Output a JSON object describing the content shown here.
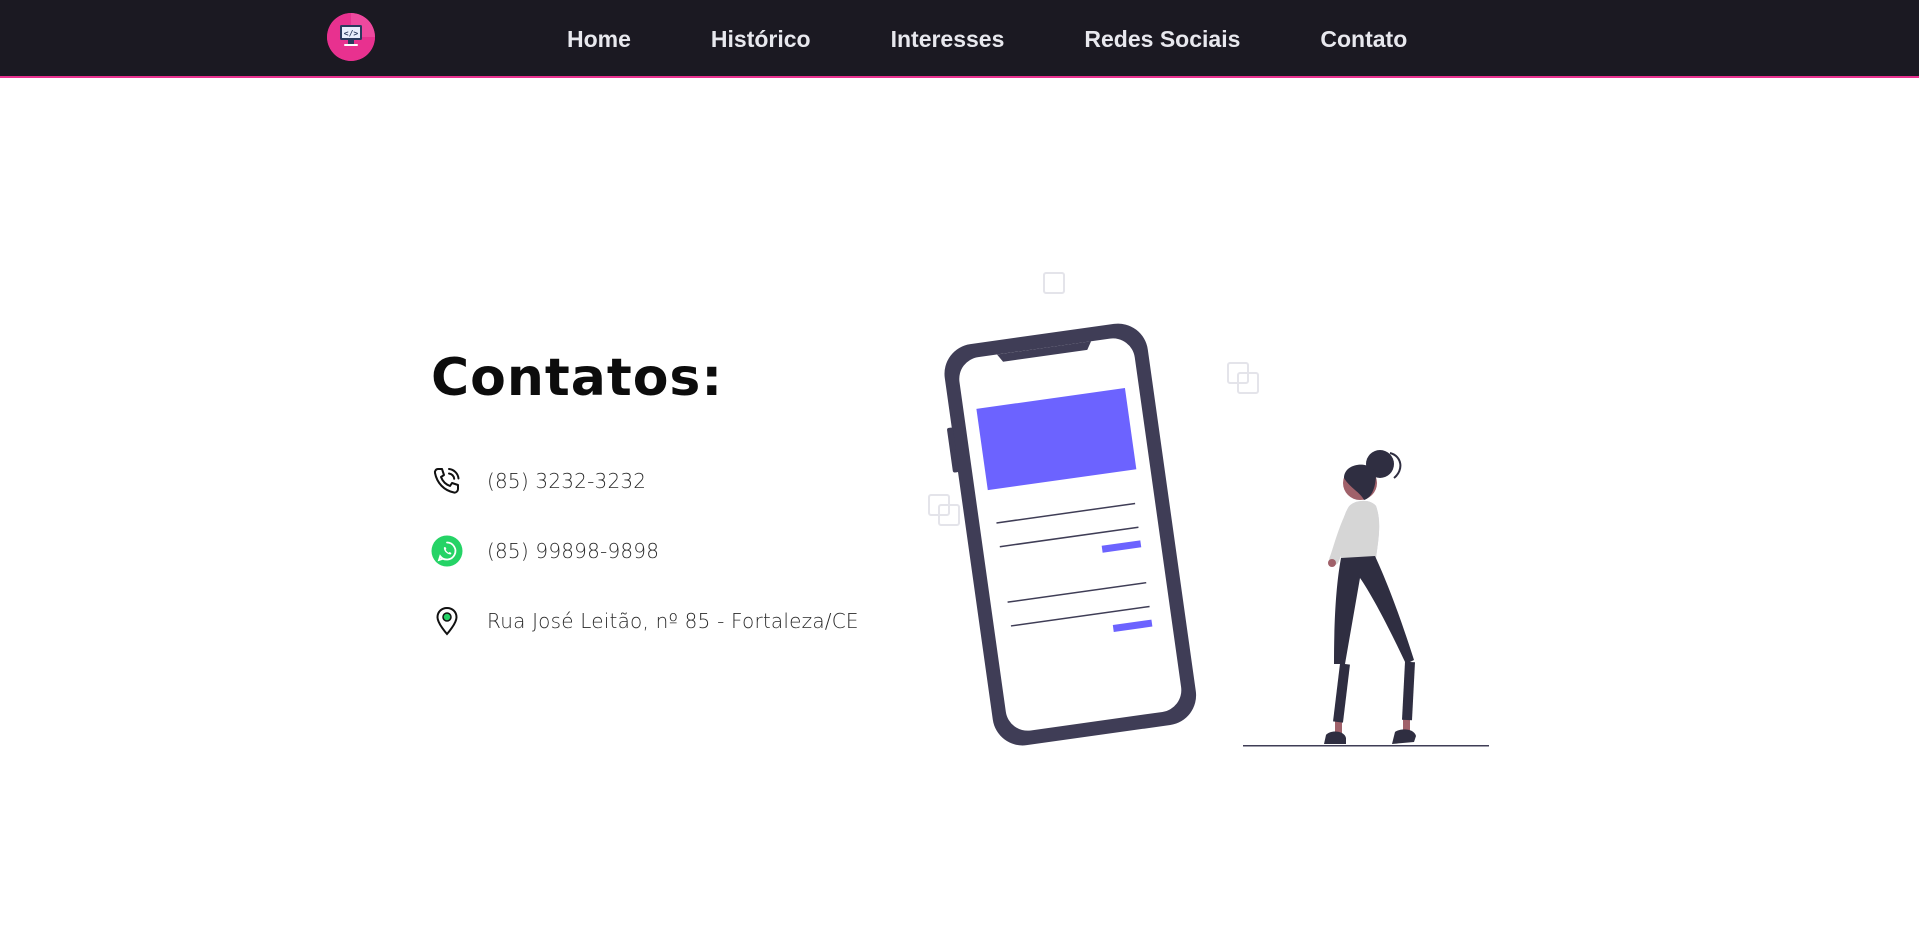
{
  "nav": {
    "logo_icon": "code-monitor-icon",
    "items": [
      {
        "label": "Home"
      },
      {
        "label": "Histórico"
      },
      {
        "label": "Interesses"
      },
      {
        "label": "Redes Sociais"
      },
      {
        "label": "Contato"
      }
    ]
  },
  "contact": {
    "title": "Contatos:",
    "phone": {
      "icon": "phone-icon",
      "text": "(85) 3232-3232"
    },
    "whatsapp": {
      "icon": "whatsapp-icon",
      "text": "(85) 99898-9898"
    },
    "address": {
      "icon": "location-pin-icon",
      "text": "Rua José Leitão, nº 85 - Fortaleza/CE"
    }
  },
  "colors": {
    "navbar_bg": "#1b1922",
    "accent": "#e8318f",
    "illustration_purple": "#6c63ff",
    "phone_frame": "#3f3d56",
    "whatsapp_green": "#25d366"
  }
}
